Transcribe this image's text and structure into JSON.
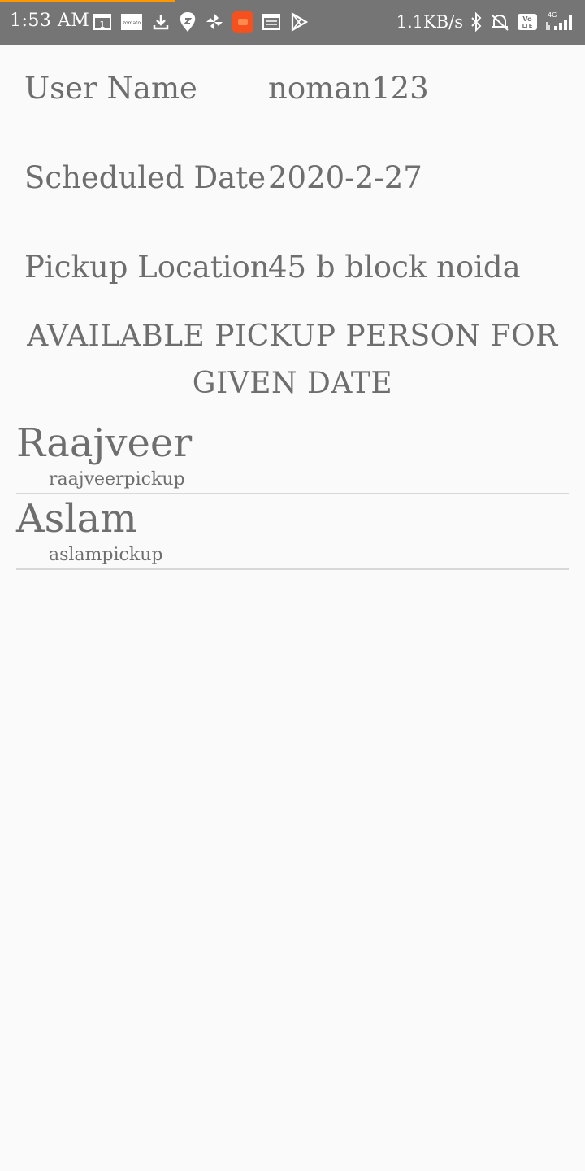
{
  "status_bar": {
    "time": "1:53 AM",
    "left_icons": [
      "calendar-icon",
      "zomato-icon",
      "download-icon",
      "swiggy-icon",
      "pinwheel-icon",
      "orange-app-icon",
      "browser-icon",
      "play-store-icon"
    ],
    "calendar_day": "1",
    "zomato_text": "zomato",
    "network_speed": "1.1KB/s",
    "right_icons": [
      "bluetooth-icon",
      "alarm-off-icon",
      "volte-icon",
      "signal-icon"
    ],
    "volte_text": "Vo LTE",
    "network_type": "4G",
    "accent_color": "#ff9800",
    "bar_color": "#757575"
  },
  "details": {
    "user_name_label": "User Name",
    "user_name_value": "noman123",
    "scheduled_date_label": "Scheduled Date",
    "scheduled_date_value": "2020-2-27",
    "pickup_location_label": "Pickup Location",
    "pickup_location_value": "45 b block noida"
  },
  "section_title": "AVAILABLE PICKUP PERSON FOR GIVEN DATE",
  "pickup_persons": [
    {
      "name": "Raajveer",
      "username": "raajveerpickup"
    },
    {
      "name": "Aslam",
      "username": "aslampickup"
    }
  ]
}
